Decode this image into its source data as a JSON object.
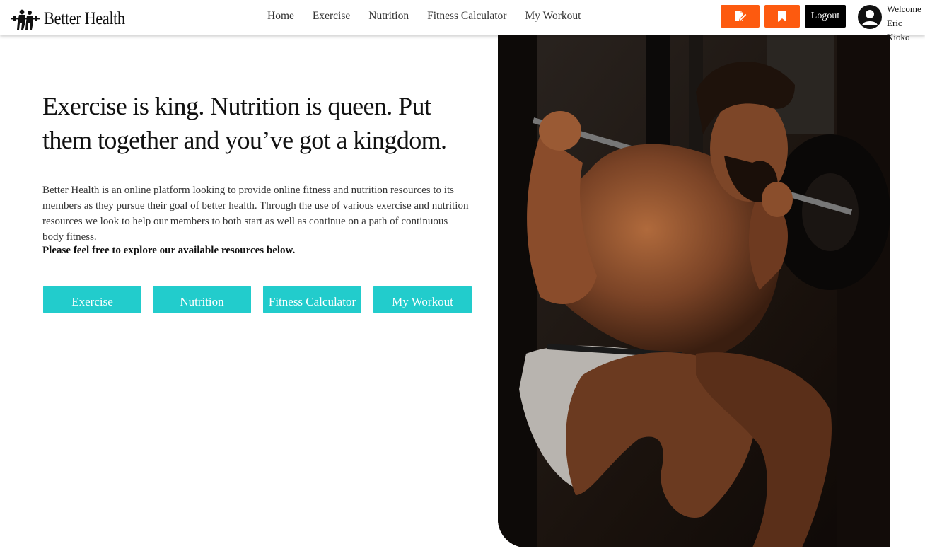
{
  "nav": {
    "brand": "Better Health",
    "links": [
      "Home",
      "Exercise",
      "Nutrition",
      "Fitness Calculator",
      "My Workout"
    ],
    "action_icons": [
      "edit-document-icon",
      "bookmark-icon"
    ],
    "logout_label": "Logout",
    "welcome_label": "Welcome",
    "user_name": "Eric Kioko"
  },
  "hero": {
    "title": "Exercise is king. Nutrition is queen. Put them together and you’ve got a kingdom.",
    "description": "Better Health is an online platform looking to provide online fitness and nutrition resources to its members as they pursue their goal of better health. Through the use of various exercise and nutrition resources we look to help our members to both start as well as continue on a path of continuous body fitness.",
    "cta": "Please feel free to explore our available resources below.",
    "buttons": [
      "Exercise",
      "Nutrition",
      "Fitness Calculator",
      "My Workout"
    ]
  },
  "colors": {
    "accent_orange": "#fd5a0f",
    "accent_teal": "#22cccc",
    "logout_bg": "#000000"
  }
}
